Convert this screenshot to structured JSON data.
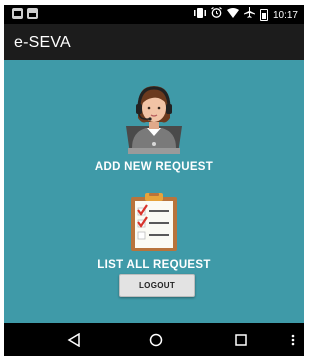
{
  "status_bar": {
    "time": "10:17",
    "left_icons": [
      "message-icon",
      "image-icon"
    ],
    "right_icons": [
      "vibrate-icon",
      "alarm-icon",
      "wifi-icon",
      "airplane-icon",
      "battery-icon"
    ]
  },
  "app_bar": {
    "title": "e-SEVA"
  },
  "main": {
    "add_request": {
      "label": "ADD NEW REQUEST",
      "icon": "support-agent-icon"
    },
    "list_request": {
      "label": "LIST ALL REQUEST",
      "icon": "clipboard-checklist-icon"
    },
    "logout_label": "LOGOUT"
  },
  "colors": {
    "background": "#3f9aa8",
    "app_bar": "#1c1c1c",
    "status_bar": "#000000",
    "checkmark": "#d8342c"
  },
  "nav_bar": {
    "buttons": [
      "back-icon",
      "home-icon",
      "recents-icon"
    ]
  }
}
